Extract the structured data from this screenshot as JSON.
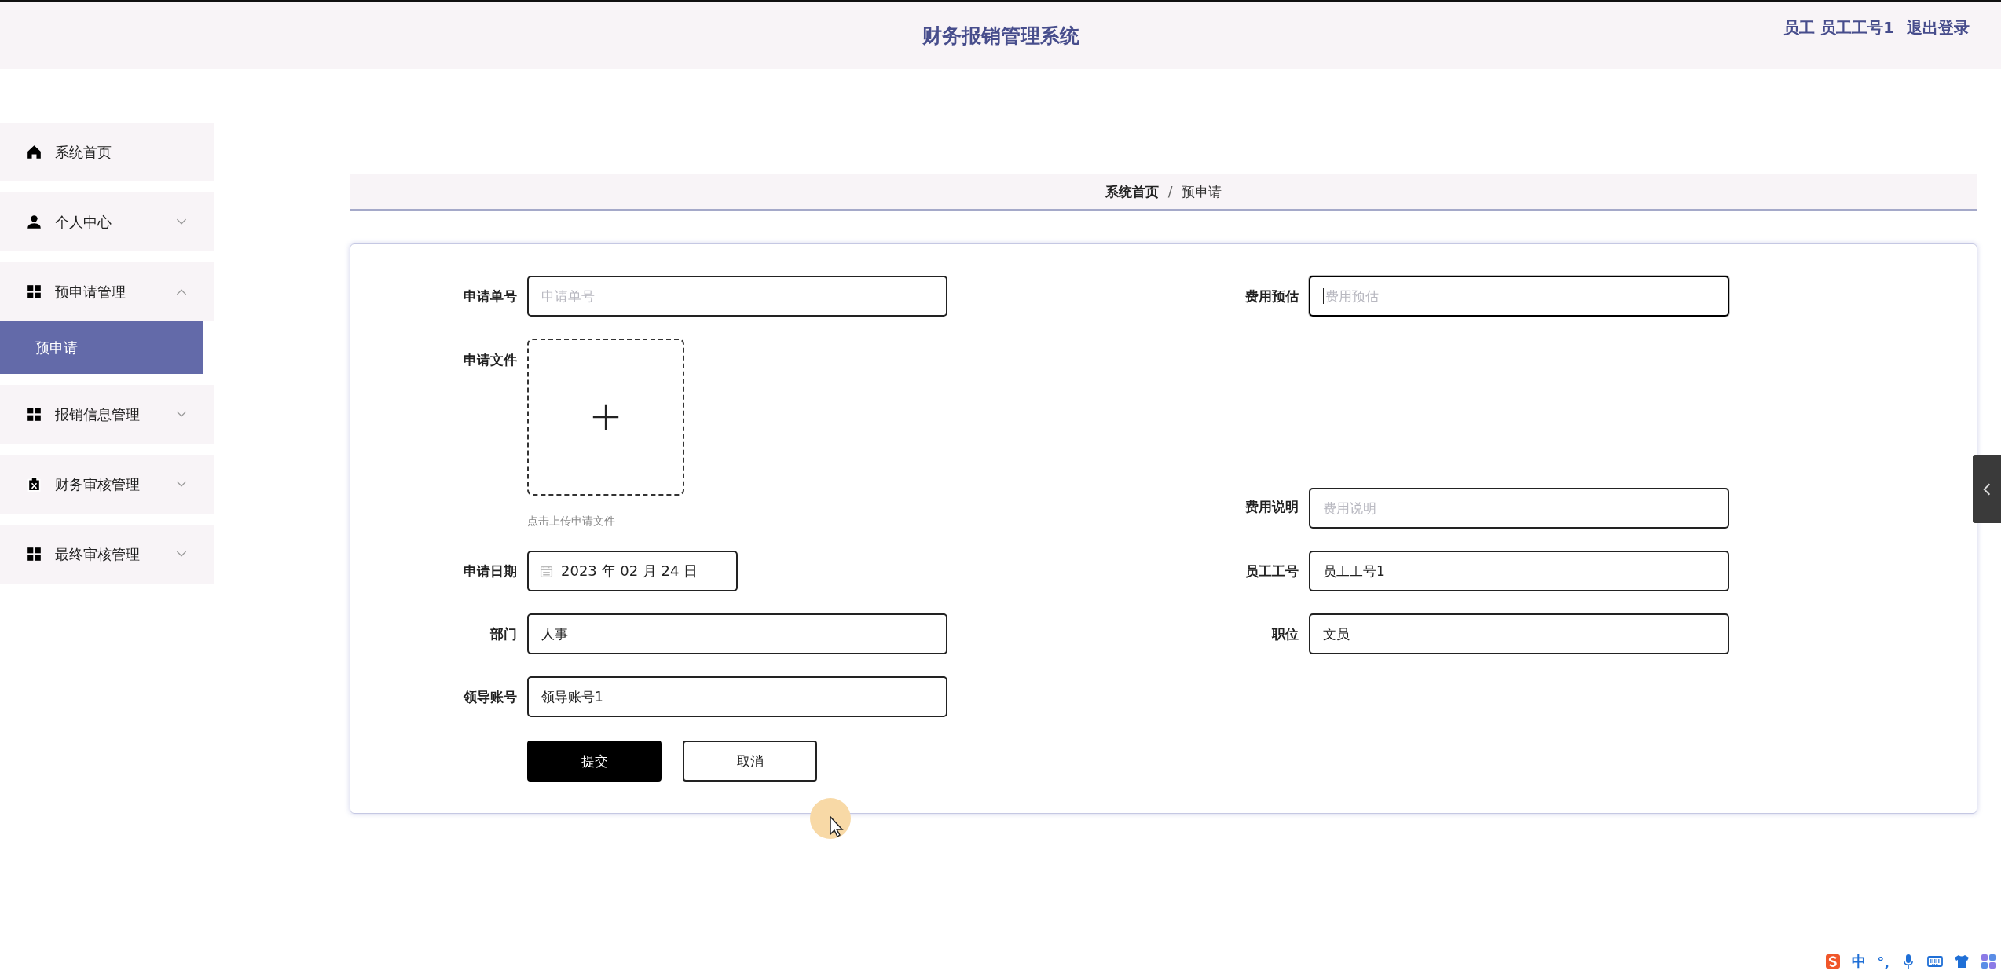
{
  "header": {
    "title": "财务报销管理系统",
    "user_role": "员工",
    "user_name": "员工工号1",
    "logout": "退出登录"
  },
  "sidebar": {
    "items": [
      {
        "kind": "home",
        "label": "系统首页",
        "selected": false
      },
      {
        "kind": "profile",
        "label": "个人中心",
        "selected": false,
        "expanded": false
      },
      {
        "kind": "grid",
        "label": "预申请管理",
        "selected": false,
        "expanded": true,
        "children": [
          {
            "label": "预申请",
            "selected": true
          }
        ]
      },
      {
        "kind": "grid",
        "label": "报销信息管理",
        "selected": false,
        "expanded": false
      },
      {
        "kind": "clipboard",
        "label": "财务审核管理",
        "selected": false,
        "expanded": false
      },
      {
        "kind": "grid",
        "label": "最终审核管理",
        "selected": false,
        "expanded": false
      }
    ]
  },
  "breadcrumb": {
    "items": [
      "系统首页",
      "预申请"
    ],
    "separator": "/"
  },
  "form": {
    "rows": [
      {
        "left": {
          "kind": "text",
          "label": "申请单号",
          "placeholder": "申请单号"
        },
        "right": {
          "kind": "text",
          "label": "费用预估",
          "placeholder": "费用预估",
          "focused": true
        }
      },
      {
        "left": {
          "kind": "upload",
          "label": "申请文件",
          "hint": "点击上传申请文件"
        },
        "right": {
          "kind": "text",
          "label": "费用说明",
          "placeholder": "费用说明",
          "focused": false
        }
      },
      {
        "left": {
          "kind": "date",
          "label": "申请日期",
          "value": "2023 年 02 月 24 日"
        },
        "right": {
          "kind": "text",
          "label": "员工工号",
          "value": "员工工号1",
          "focused": false
        }
      },
      {
        "left": {
          "kind": "text",
          "label": "部门",
          "value": "人事"
        },
        "right": {
          "kind": "text",
          "label": "职位",
          "value": "文员",
          "focused": false
        }
      },
      {
        "left": {
          "kind": "text",
          "label": "领导账号",
          "value": "领导账号1"
        }
      }
    ],
    "buttons": [
      {
        "kind": "primary",
        "label": "提交"
      },
      {
        "kind": "secondary",
        "label": "取消"
      }
    ]
  },
  "ime_bar": {
    "mode": "中",
    "punctuation": "°,"
  }
}
